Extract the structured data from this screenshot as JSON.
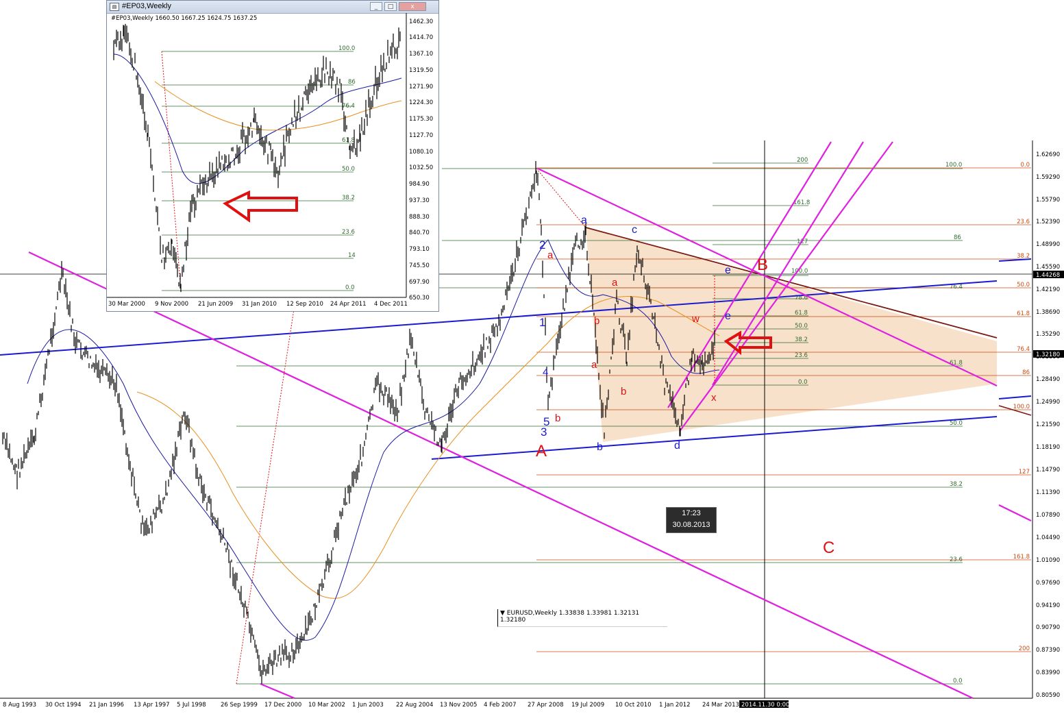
{
  "main_chart": {
    "symbol_info": "EURUSD,Weekly  1.33838 1.33981 1.32131 1.32180",
    "price_label_current": "1.32180",
    "price_label_cross": "1.44268",
    "crosshair_time": "2014.11.30 0:00",
    "tooltip_time": "17:23",
    "tooltip_date": "30.08.2013",
    "y_axis": [
      "1.62690",
      "1.59290",
      "1.55790",
      "1.52390",
      "1.48990",
      "1.45590",
      "1.42190",
      "1.38690",
      "1.35290",
      "1.31890",
      "1.28490",
      "1.24990",
      "1.21590",
      "1.18190",
      "1.14790",
      "1.11390",
      "1.07890",
      "1.04490",
      "1.01090",
      "0.97690",
      "0.94190",
      "0.90790",
      "0.87390",
      "0.83990",
      "0.80590"
    ],
    "x_axis": [
      "8 Aug 1993",
      "30 Oct 1994",
      "21 Jan 1996",
      "13 Apr 1997",
      "5 Jul 1998",
      "26 Sep 1999",
      "17 Dec 2000",
      "10 Mar 2002",
      "1 Jun 2003",
      "22 Aug 2004",
      "13 Nov 2005",
      "4 Feb 2007",
      "27 Apr 2008",
      "19 Jul 2009",
      "10 Oct 2010",
      "1 Jan 2012",
      "24 Mar 2013"
    ],
    "fib_green_left": [
      "200",
      "161.8",
      "127",
      "100.0",
      "78.6",
      "61.8",
      "50.0",
      "38.2",
      "23.6",
      "0.0"
    ],
    "fib_green_right": [
      "100.0",
      "86",
      "76.4",
      "61.8",
      "50.0",
      "38.2",
      "23.6",
      "0.0"
    ],
    "fib_red": [
      "0.0",
      "23.6",
      "38.2",
      "50.0",
      "61.8",
      "76.4",
      "86",
      "100.0",
      "127",
      "161.8",
      "200"
    ],
    "wave_labels": {
      "A": "A",
      "B": "B",
      "C": "C",
      "blue_a": "a",
      "blue_b": "b",
      "blue_c": "c",
      "blue_d": "d",
      "blue_e1": "e",
      "blue_e2": "e",
      "blue_1": "1",
      "blue_2": "2",
      "blue_3": "3",
      "blue_4": "4",
      "blue_5": "5",
      "red_a1": "a",
      "red_a2": "a",
      "red_a3": "a",
      "red_b1": "b",
      "red_b2": "b",
      "red_b3": "b",
      "red_w": "w",
      "red_x": "x"
    },
    "colors": {
      "magenta": "#e020e0",
      "blue": "#1a1ad0",
      "brown": "#7a1a10",
      "red": "#e01010",
      "fib_green": "#2f6b2f",
      "fib_red": "#d04a10",
      "triangle_fill": "#f6d9bd"
    }
  },
  "inset": {
    "title": "#EP03,Weekly",
    "header_info": "#EP03,Weekly  1660.50 1667.25 1624.75 1637.25",
    "y_axis": [
      "1462.30",
      "1414.70",
      "1367.10",
      "1319.50",
      "1271.90",
      "1224.30",
      "1175.30",
      "1127.70",
      "1080.10",
      "1032.50",
      "984.90",
      "937.30",
      "888.30",
      "840.70",
      "793.10",
      "745.50",
      "697.90",
      "650.30"
    ],
    "x_axis": [
      "30 Mar 2000",
      "9 Nov 2000",
      "21 Jun 2009",
      "31 Jan 2010",
      "12 Sep 2010",
      "24 Apr 2011",
      "4 Dec 2011"
    ],
    "fib_labels": [
      "100.0",
      "86",
      "76.4",
      "61.8",
      "50.0",
      "38.2",
      "23.6",
      "14",
      "0.0"
    ],
    "buttons": {
      "minimize": "_",
      "maximize": "□",
      "close": "x"
    }
  }
}
